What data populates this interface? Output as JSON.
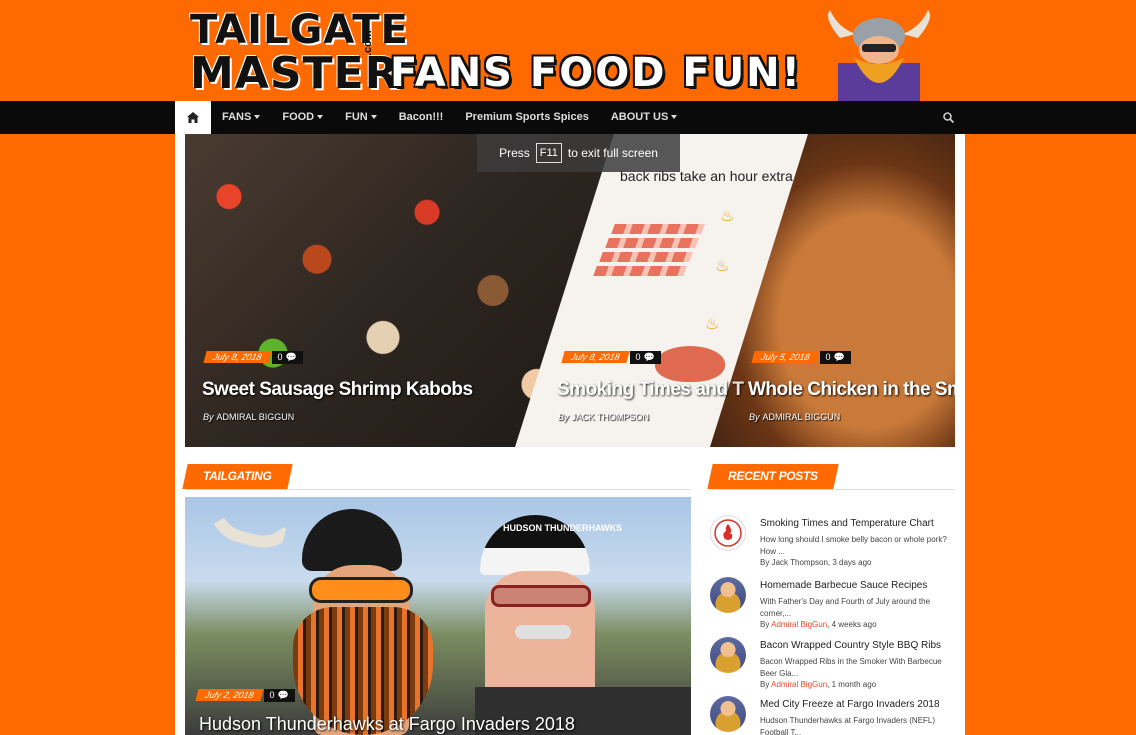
{
  "header": {
    "logo_line1": "TAILGATE",
    "logo_line2": "MASTER",
    "logo_suffix": ".com",
    "tagline": "FANS FOOD FUN!"
  },
  "nav": {
    "items": [
      {
        "label": "FANS",
        "dropdown": true
      },
      {
        "label": "FOOD",
        "dropdown": true
      },
      {
        "label": "FUN",
        "dropdown": true
      },
      {
        "label": "Bacon!!!",
        "dropdown": false
      },
      {
        "label": "Premium Sports Spices",
        "dropdown": false
      },
      {
        "label": "ABOUT US",
        "dropdown": true
      }
    ]
  },
  "fullscreen_notice": {
    "press": "Press",
    "key": "F11",
    "suffix": "to exit full screen"
  },
  "slider": {
    "slides": [
      {
        "date": "July 8, 2018",
        "comments": "0",
        "title": "Sweet Sausage Shrimp Kabobs",
        "by": "By",
        "author": "ADMIRAL BIGGUN"
      },
      {
        "date": "July 8, 2018",
        "comments": "0",
        "title": "Smoking Times and T",
        "by": "By",
        "author": "JACK THOMPSON",
        "chart_heading": "back ribs take an hour extra to"
      },
      {
        "date": "July 5, 2018",
        "comments": "0",
        "title": "Whole Chicken in the Smok",
        "by": "By",
        "author": "ADMIRAL BIGGUN"
      }
    ]
  },
  "tailgating": {
    "section_label": "TAILGATING",
    "post": {
      "date": "July 2, 2018",
      "comments": "0",
      "title": "Hudson Thunderhawks at Fargo Invaders 2018",
      "cap_text": "HUDSON THUNDERHAWKS"
    }
  },
  "recent_posts": {
    "section_label": "RECENT POSTS",
    "items": [
      {
        "title": "Smoking Times and Temperature Chart",
        "excerpt": "How long should I smoke belly bacon or whole pork? How ...",
        "by": "By",
        "author": "Jack Thompson",
        "author_link": false,
        "time": "3 days  ago",
        "avatar": "hungry-logo"
      },
      {
        "title": "Homemade Barbecue Sauce Recipes",
        "excerpt": "With Father's Day and Fourth of July around the corner,...",
        "by": "By",
        "author": "Admiral BigGun",
        "author_link": true,
        "time": "4 weeks  ago",
        "avatar": "viking"
      },
      {
        "title": "Bacon Wrapped Country Style BBQ Ribs",
        "excerpt": "Bacon Wrapped Ribs in the Smoker With Barbecue Beer Gla...",
        "by": "By",
        "author": "Admiral BigGun",
        "author_link": true,
        "time": "1 month  ago",
        "avatar": "viking"
      },
      {
        "title": "Med City Freeze at Fargo Invaders 2018",
        "excerpt": "Hudson Thunderhawks at Fargo Invaders (NEFL) Football T...",
        "by": "",
        "author": "",
        "author_link": false,
        "time": "",
        "avatar": "viking"
      }
    ]
  },
  "colors": {
    "accent": "#ff6a00",
    "navbar": "#0a0a0a",
    "author_link": "#e84a2a"
  }
}
